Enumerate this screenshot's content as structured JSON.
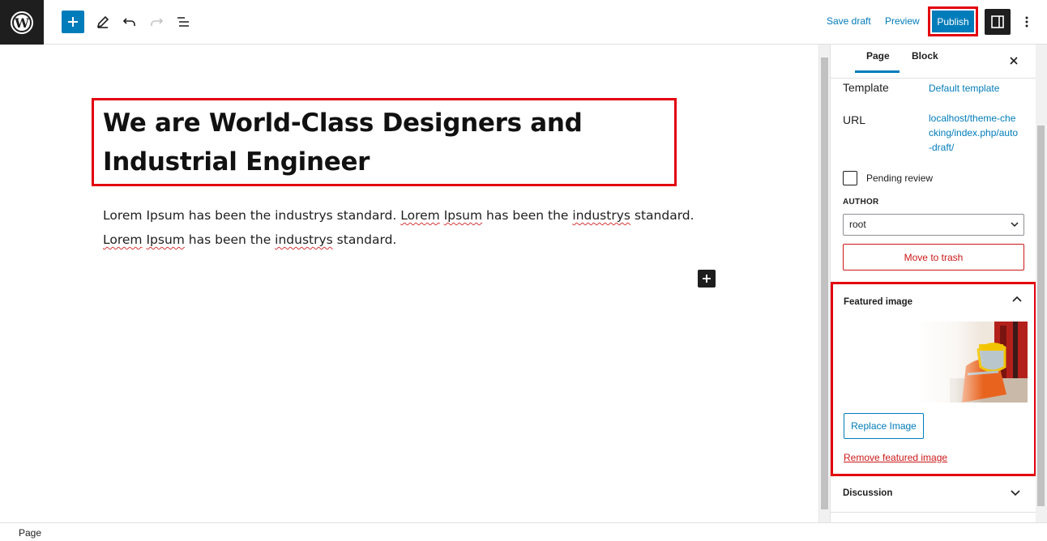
{
  "toolbar": {
    "save_draft": "Save draft",
    "preview": "Preview",
    "publish": "Publish"
  },
  "editor": {
    "title": "We are World-Class Designers and Industrial Engineer",
    "paragraph": [
      {
        "t": "Lorem Ipsum has been the industrys standard. ",
        "sq": false
      },
      {
        "t": "Lorem",
        "sq": true
      },
      {
        "t": " ",
        "sq": false
      },
      {
        "t": "Ipsum",
        "sq": true
      },
      {
        "t": " has been the ",
        "sq": false
      },
      {
        "t": "industrys",
        "sq": true
      },
      {
        "t": " standard. ",
        "sq": false
      },
      {
        "t": "Lorem",
        "sq": true
      },
      {
        "t": " ",
        "sq": false
      },
      {
        "t": "Ipsum",
        "sq": true
      },
      {
        "t": " has been the ",
        "sq": false
      },
      {
        "t": "industrys",
        "sq": true
      },
      {
        "t": " standard.",
        "sq": false
      }
    ]
  },
  "sidebar": {
    "tabs": {
      "page": "Page",
      "block": "Block"
    },
    "template_label": "Template",
    "template_value": "Default template",
    "url_label": "URL",
    "url_value": "localhost/theme-checking/index.php/auto-draft/",
    "pending_review": "Pending review",
    "author_label": "AUTHOR",
    "author_value": "root",
    "move_to_trash": "Move to trash",
    "featured_image_title": "Featured image",
    "replace_image": "Replace Image",
    "remove_featured_image": "Remove featured image",
    "discussion": "Discussion"
  },
  "footer": {
    "breadcrumb": "Page"
  },
  "colors": {
    "accent": "#007cba",
    "highlight": "#e3000f",
    "danger": "#cc1818",
    "dark": "#1e1e1e"
  }
}
